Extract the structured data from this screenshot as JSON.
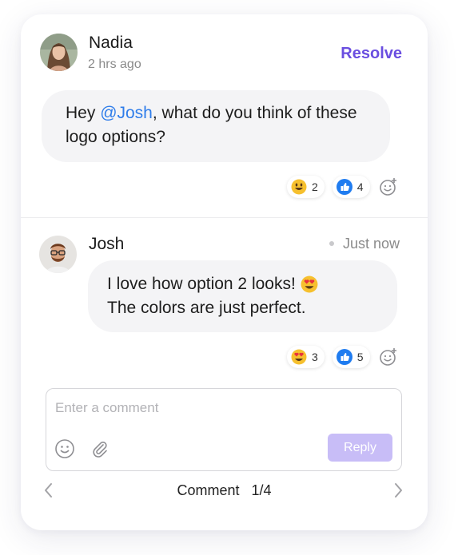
{
  "thread": {
    "resolve_label": "Resolve",
    "comments": [
      {
        "author": "Nadia",
        "time": "2 hrs ago",
        "message_prefix": "Hey ",
        "mention": "@Josh",
        "message_suffix": ", what do you think of these logo options?",
        "reactions": [
          {
            "emoji": "smiley-emoji",
            "count": "2"
          },
          {
            "emoji": "thumbs-up-emoji",
            "count": "4"
          }
        ]
      },
      {
        "author": "Josh",
        "time": "Just now",
        "message_line1": "I love how option 2 looks!",
        "message_line2": "The colors are just perfect.",
        "reactions": [
          {
            "emoji": "heart-eyes-emoji",
            "count": "3"
          },
          {
            "emoji": "thumbs-up-emoji",
            "count": "5"
          }
        ]
      }
    ]
  },
  "composer": {
    "placeholder": "Enter a comment",
    "value": "",
    "reply_label": "Reply"
  },
  "pager": {
    "label": "Comment",
    "position": "1/4"
  },
  "colors": {
    "accent": "#6a4ee0",
    "mention": "#2f7dea",
    "reply_button": "#c8bdf7",
    "bubble": "#f4f4f6"
  }
}
